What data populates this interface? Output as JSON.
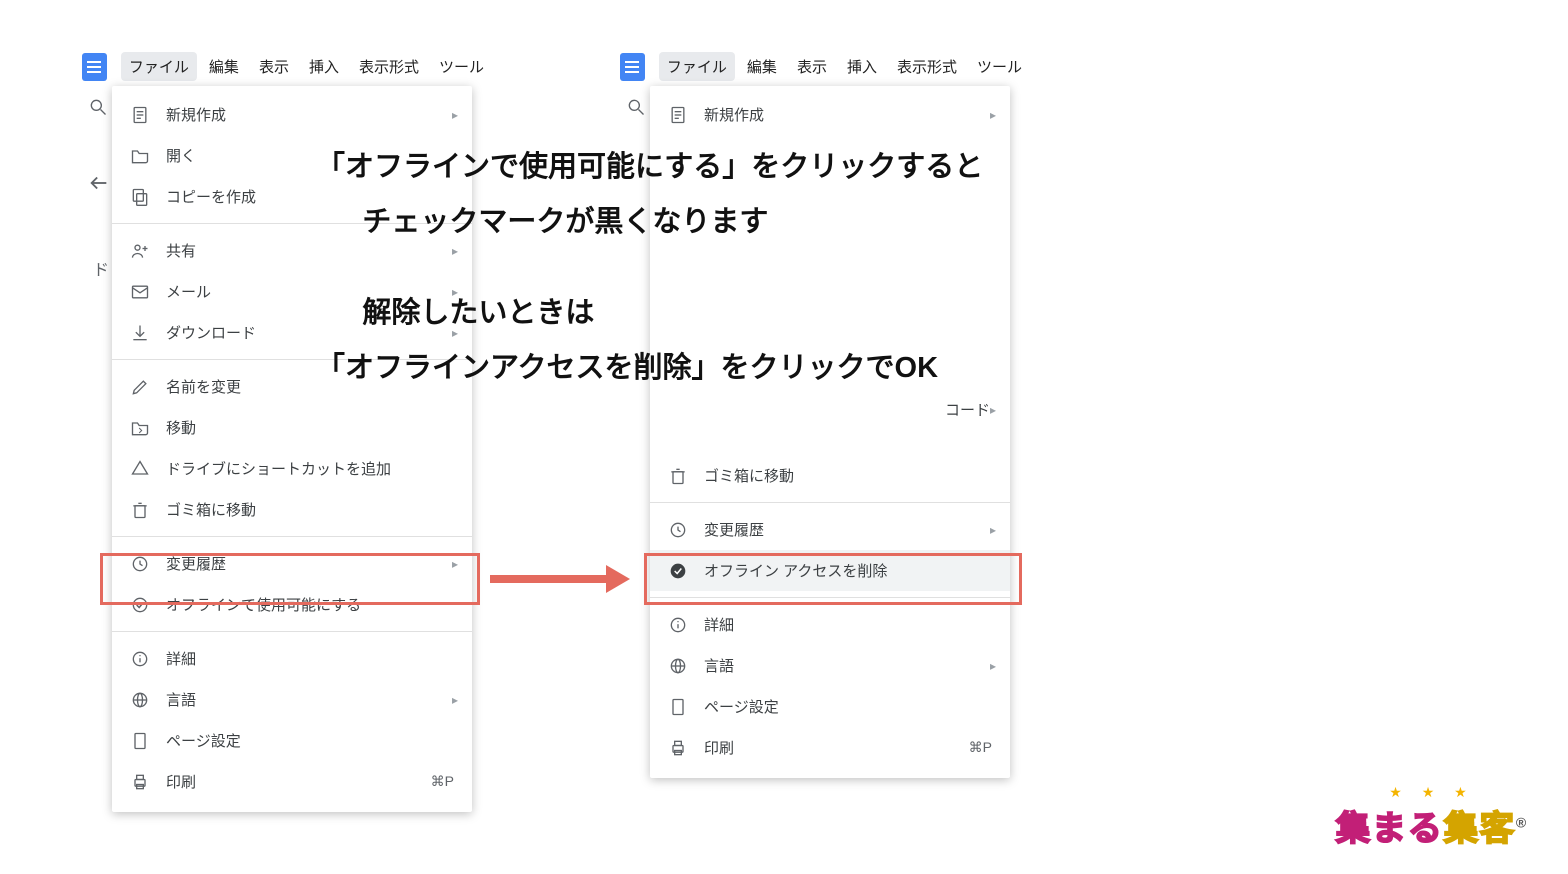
{
  "menubar": {
    "file": "ファイル",
    "edit": "編集",
    "view": "表示",
    "insert": "挿入",
    "format": "表示形式",
    "tools": "ツール"
  },
  "menu": {
    "new": "新規作成",
    "open": "開く",
    "copy": "コピーを作成",
    "share": "共有",
    "mail": "メール",
    "download": "ダウンロード",
    "rename": "名前を変更",
    "move": "移動",
    "shortcut": "ドライブにショートカットを追加",
    "trash": "ゴミ箱に移動",
    "history": "変更履歴",
    "offline_on": "オフラインで使用可能にする",
    "offline_off": "オフライン アクセスを削除",
    "details": "詳細",
    "language": "言語",
    "pagesetup": "ページ設定",
    "print": "印刷",
    "print_key": "⌘P"
  },
  "remnant": "コード",
  "explain": {
    "line1": "「オフラインで使用可能にする」をクリックすると",
    "line2": "チェックマークが黒くなります",
    "line3": "解除したいときは",
    "line4": "「オフラインアクセスを削除」をクリックでOK"
  },
  "brand": {
    "a": "集まる",
    "b": "集客",
    "reg": "®"
  },
  "side_letter": "ド"
}
